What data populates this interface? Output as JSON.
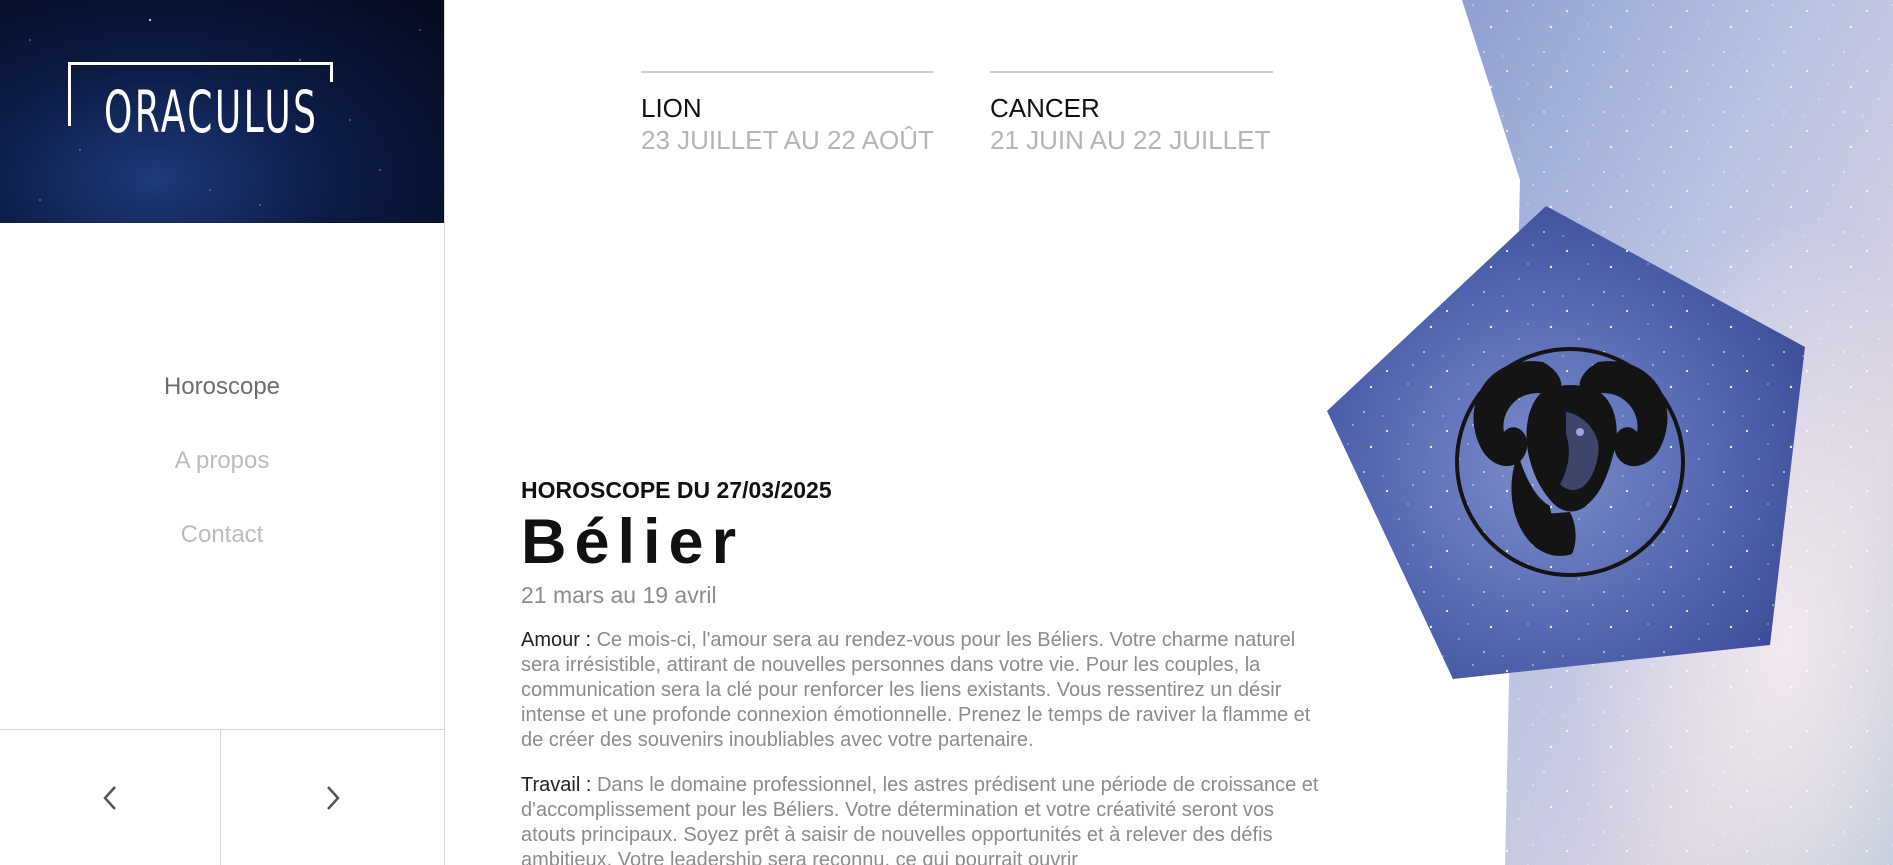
{
  "brand": {
    "logo_text": "ORACULUS"
  },
  "nav": {
    "items": [
      {
        "label": "Horoscope",
        "active": true
      },
      {
        "label": "A propos",
        "active": false
      },
      {
        "label": "Contact",
        "active": false
      }
    ]
  },
  "pager": {
    "prev_icon": "chevron-left-icon",
    "next_icon": "chevron-right-icon"
  },
  "signs_nav": [
    {
      "name": "LION",
      "dates": "23 JUILLET AU 22 AOÛT"
    },
    {
      "name": "CANCER",
      "dates": "21 JUIN AU 22 JUILLET"
    }
  ],
  "horoscope": {
    "date_heading": "HOROSCOPE DU 27/03/2025",
    "sign": "Bélier",
    "range": "21 mars au 19 avril",
    "love_label": "Amour :",
    "love_text": "Ce mois-ci, l'amour sera au rendez-vous pour les Béliers. Votre charme naturel sera irrésistible, attirant de nouvelles personnes dans votre vie. Pour les couples, la communication sera la clé pour renforcer les liens existants. Vous ressentirez un désir intense et une profonde connexion émotionnelle. Prenez le temps de raviver la flamme et de créer des souvenirs inoubliables avec votre partenaire.",
    "work_label": "Travail :",
    "work_text": "Dans le domaine professionnel, les astres prédisent une période de croissance et d'accomplissement pour les Béliers. Votre détermination et votre créativité seront vos atouts principaux. Soyez prêt à saisir de nouvelles opportunités et à relever des défis ambitieux. Votre leadership sera reconnu, ce qui pourrait ouvrir"
  },
  "visual": {
    "zodiac_icon": "ram-aries-icon",
    "sky_colors": [
      "#9fb0d8",
      "#c8cfe6",
      "#6d7fb8"
    ],
    "pentagon_colors": [
      "#3d4f9a",
      "#6f7fc2",
      "#9aa8dc"
    ]
  }
}
